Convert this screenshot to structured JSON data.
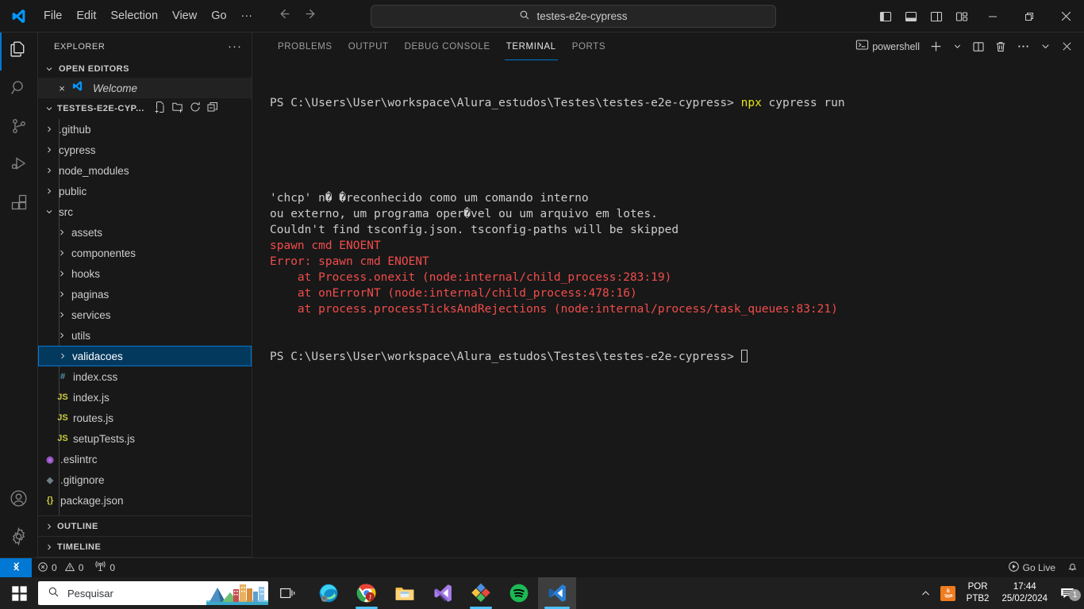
{
  "titlebar": {
    "menus": [
      "File",
      "Edit",
      "Selection",
      "View",
      "Go",
      "···"
    ],
    "search_value": "testes-e2e-cypress",
    "search_icon": "search-icon",
    "back_icon": "arrow-left-icon",
    "forward_icon": "arrow-right-icon",
    "layout_buttons": [
      "toggle-primary-sidebar-icon",
      "toggle-panel-icon",
      "toggle-secondary-sidebar-icon",
      "customize-layout-icon"
    ],
    "window_buttons": [
      "minimize-icon",
      "restore-icon",
      "close-icon"
    ]
  },
  "activitybar": {
    "items": [
      {
        "name": "explorer",
        "icon": "files-icon",
        "active": true
      },
      {
        "name": "search",
        "icon": "search-icon",
        "active": false
      },
      {
        "name": "source-control",
        "icon": "source-control-icon",
        "active": false
      },
      {
        "name": "run-and-debug",
        "icon": "run-debug-icon",
        "active": false
      },
      {
        "name": "extensions",
        "icon": "extensions-icon",
        "active": false
      }
    ],
    "bottom": [
      {
        "name": "accounts",
        "icon": "account-icon"
      },
      {
        "name": "manage",
        "icon": "gear-icon"
      }
    ]
  },
  "sidebar": {
    "title": "EXPLORER",
    "more_actions": "···",
    "open_editors": {
      "label": "OPEN EDITORS",
      "items": [
        {
          "label": "Welcome",
          "icon": "vscode-icon",
          "close": "×"
        }
      ]
    },
    "workspace": {
      "label": "TESTES-E2E-CYP...",
      "actions": [
        "new-file-icon",
        "new-folder-icon",
        "refresh-icon",
        "collapse-all-icon"
      ]
    },
    "tree": [
      {
        "label": ".github",
        "type": "folder",
        "depth": 1,
        "expanded": false
      },
      {
        "label": "cypress",
        "type": "folder",
        "depth": 1,
        "expanded": false
      },
      {
        "label": "node_modules",
        "type": "folder",
        "depth": 1,
        "expanded": false
      },
      {
        "label": "public",
        "type": "folder",
        "depth": 1,
        "expanded": false
      },
      {
        "label": "src",
        "type": "folder",
        "depth": 1,
        "expanded": true
      },
      {
        "label": "assets",
        "type": "folder",
        "depth": 2,
        "expanded": false
      },
      {
        "label": "componentes",
        "type": "folder",
        "depth": 2,
        "expanded": false
      },
      {
        "label": "hooks",
        "type": "folder",
        "depth": 2,
        "expanded": false
      },
      {
        "label": "paginas",
        "type": "folder",
        "depth": 2,
        "expanded": false
      },
      {
        "label": "services",
        "type": "folder",
        "depth": 2,
        "expanded": false
      },
      {
        "label": "utils",
        "type": "folder",
        "depth": 2,
        "expanded": false
      },
      {
        "label": "validacoes",
        "type": "folder",
        "depth": 2,
        "expanded": false,
        "selected": true
      },
      {
        "label": "index.css",
        "type": "file",
        "depth": 2,
        "icon": "#",
        "color": "#519aba"
      },
      {
        "label": "index.js",
        "type": "file",
        "depth": 2,
        "icon": "JS",
        "color": "#cbcb41"
      },
      {
        "label": "routes.js",
        "type": "file",
        "depth": 2,
        "icon": "JS",
        "color": "#cbcb41"
      },
      {
        "label": "setupTests.js",
        "type": "file",
        "depth": 2,
        "icon": "JS",
        "color": "#cbcb41"
      },
      {
        "label": ".eslintrc",
        "type": "file",
        "depth": 1,
        "icon": "◉",
        "color": "#b267e6"
      },
      {
        "label": ".gitignore",
        "type": "file",
        "depth": 1,
        "icon": "◆",
        "color": "#6d8086"
      },
      {
        "label": "package.json",
        "type": "file",
        "depth": 1,
        "icon": "{}",
        "color": "#cbcb41"
      }
    ],
    "bottom_sections": [
      {
        "label": "OUTLINE"
      },
      {
        "label": "TIMELINE"
      }
    ]
  },
  "panel": {
    "tabs": [
      {
        "label": "PROBLEMS",
        "active": false
      },
      {
        "label": "OUTPUT",
        "active": false
      },
      {
        "label": "DEBUG CONSOLE",
        "active": false
      },
      {
        "label": "TERMINAL",
        "active": true
      },
      {
        "label": "PORTS",
        "active": false
      }
    ],
    "shell_name": "powershell",
    "shell_icon": "terminal-powershell-icon",
    "actions": [
      "new-terminal-icon",
      "chevron-down-icon",
      "split-terminal-icon",
      "kill-terminal-icon",
      "more-actions-icon",
      "hide-panel-icon",
      "close-panel-icon"
    ]
  },
  "terminal": {
    "prompt1": "PS C:\\Users\\User\\workspace\\Alura_estudos\\Testes\\testes-e2e-cypress> ",
    "command1_cmd": "npx",
    "command1_args": " cypress run",
    "lines": [
      {
        "segments": [
          {
            "text": "'chcp' n� �reconhecido como um comando interno",
            "color": "white"
          }
        ]
      },
      {
        "segments": [
          {
            "text": "ou externo, um programa oper�vel ou um arquivo em lotes.",
            "color": "white"
          }
        ]
      },
      {
        "segments": [
          {
            "text": "Couldn't find tsconfig.json. tsconfig-paths will be skipped",
            "color": "white"
          }
        ]
      },
      {
        "segments": [
          {
            "text": "spawn cmd ENOENT",
            "color": "red"
          }
        ]
      },
      {
        "segments": [
          {
            "text": "Error: spawn cmd ENOENT",
            "color": "red"
          }
        ]
      },
      {
        "segments": [
          {
            "text": "    at Process.onexit (node:internal/child_process:283:19)",
            "color": "red"
          }
        ]
      },
      {
        "segments": [
          {
            "text": "    at onErrorNT (node:internal/child_process:478:16)",
            "color": "red"
          }
        ]
      },
      {
        "segments": [
          {
            "text": "    at process.processTicksAndRejections (node:internal/process/task_queues:83:21)",
            "color": "red"
          }
        ]
      }
    ],
    "prompt2": "PS C:\\Users\\User\\workspace\\Alura_estudos\\Testes\\testes-e2e-cypress> "
  },
  "statusbar": {
    "remote_icon": "remote-window-icon",
    "errors_icon": "error-icon",
    "errors_count": "0",
    "warnings_icon": "warning-icon",
    "warnings_count": "0",
    "ports_icon": "radio-tower-icon",
    "ports_count": "0",
    "go_live_icon": "broadcast-icon",
    "go_live_label": "Go Live",
    "bell_icon": "bell-icon"
  },
  "taskbar": {
    "start_icon": "windows-start-icon",
    "search_placeholder": "Pesquisar",
    "search_icon": "search-icon",
    "taskview_icon": "task-view-icon",
    "apps": [
      {
        "name": "microsoft-edge",
        "running": false
      },
      {
        "name": "google-chrome",
        "running": true
      },
      {
        "name": "file-explorer",
        "running": false
      },
      {
        "name": "visual-studio",
        "running": false
      },
      {
        "name": "paint-3d",
        "running": true
      },
      {
        "name": "spotify",
        "running": false
      },
      {
        "name": "visual-studio-code",
        "running": true,
        "active": true
      }
    ],
    "tray": {
      "chevron_icon": "show-hidden-icons-icon",
      "java_icon": "java-icon",
      "lang_line1": "POR",
      "lang_line2": "PTB2",
      "time": "17:44",
      "date": "25/02/2024",
      "notification_icon": "notification-icon",
      "notification_count": "1"
    }
  }
}
